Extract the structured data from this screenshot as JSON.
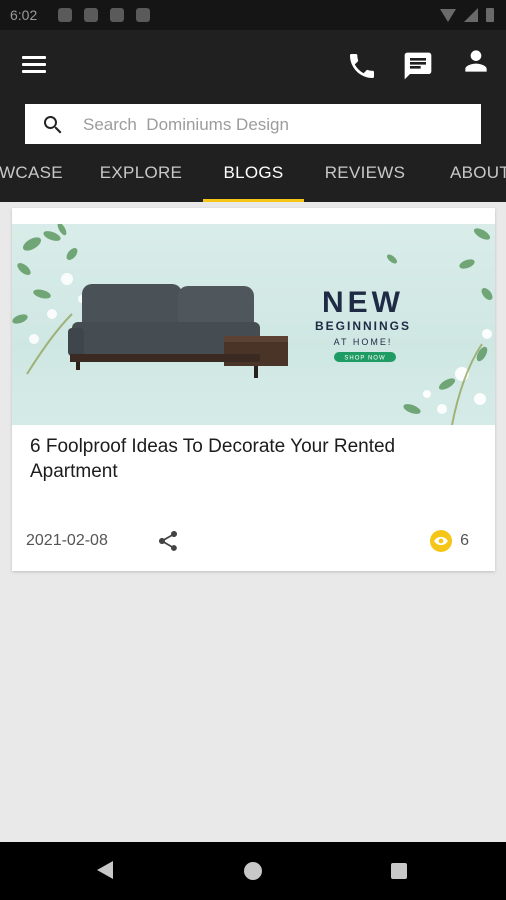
{
  "status_bar": {
    "time": "6:02"
  },
  "search": {
    "placeholder": "Search  Dominiums Design"
  },
  "tabs": [
    {
      "label": "WCASE"
    },
    {
      "label": "EXPLORE"
    },
    {
      "label": "BLOGS",
      "active": true
    },
    {
      "label": "REVIEWS"
    },
    {
      "label": "ABOUT"
    }
  ],
  "blog_card": {
    "banner": {
      "headline": "NEW",
      "line1": "BEGINNINGS",
      "line2": "AT HOME!",
      "cta": "SHOP NOW"
    },
    "title": "6 Foolproof Ideas To Decorate Your Rented Apartment",
    "date": "2021-02-08",
    "views": "6"
  },
  "colors": {
    "accent": "#f5c518",
    "header_bg": "#202020",
    "page_bg": "#e9e9e9"
  },
  "icons": [
    "menu-icon",
    "phone-icon",
    "chat-icon",
    "account-icon",
    "search-icon",
    "share-icon",
    "eye-icon"
  ]
}
